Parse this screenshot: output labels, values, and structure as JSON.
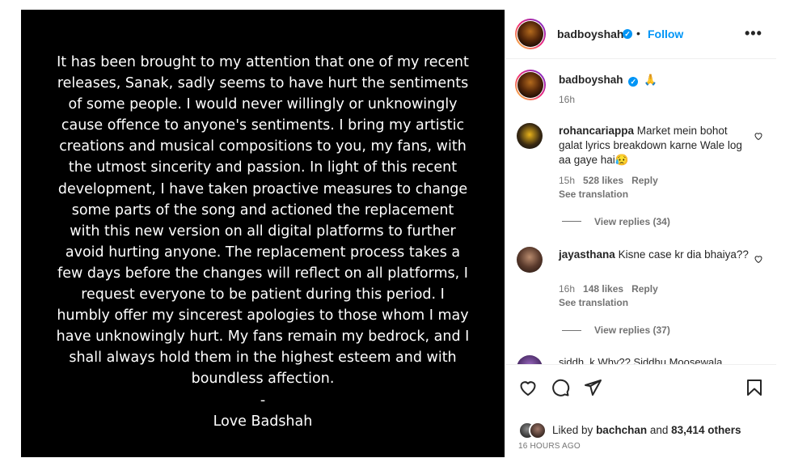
{
  "statement": {
    "body": "It has been brought to my attention that one of my recent releases, Sanak, sadly seems to have hurt the sentiments of some people. I would never willingly or unknowingly cause offence to anyone's sentiments. I bring my artistic creations and musical compositions to you, my fans, with the utmost sincerity and passion. In light of this recent development, I have taken proactive measures to change some parts of the song and actioned the replacement with this new version on all digital platforms to further avoid hurting anyone. The replacement process takes a few days before the changes will reflect on all platforms, I request everyone to be patient during this period. I humbly offer my sincerest apologies to those whom I may have unknowingly hurt. My fans remain my bedrock, and I shall always hold them in the highest esteem and with boundless affection.",
    "dash": "-",
    "signature": "Love Badshah"
  },
  "header": {
    "username": "badboyshah",
    "separator": "•",
    "follow_label": "Follow",
    "more_label": "•••"
  },
  "caption": {
    "username": "badboyshah",
    "text": "🙏",
    "time": "16h"
  },
  "comments": [
    {
      "username": "rohancariappa",
      "text": "Market mein bohot galat lyrics breakdown karne Wale log aa gaye hai😥",
      "time": "15h",
      "likes": "528 likes",
      "reply_label": "Reply",
      "translation_label": "See translation",
      "view_replies": "View replies (34)"
    },
    {
      "username": "jayasthana",
      "text": "Kisne case kr dia bhaiya??",
      "time": "16h",
      "likes": "148 likes",
      "reply_label": "Reply",
      "translation_label": "See translation",
      "view_replies": "View replies (37)"
    }
  ],
  "partial_comment": "siddh_k Why?? Siddhu Moosewala",
  "likes": {
    "prefix": "Liked by",
    "user": "bachchan",
    "middle": "and",
    "others": "83,414 others"
  },
  "time_ago": "16 HOURS AGO",
  "icons": [
    "heart-icon",
    "comment-icon",
    "share-icon",
    "bookmark-icon",
    "verified-badge-icon",
    "more-options-icon"
  ],
  "colors": {
    "accent": "#0095f6",
    "muted": "#737373",
    "text": "#262626",
    "media_bg": "#000000"
  }
}
